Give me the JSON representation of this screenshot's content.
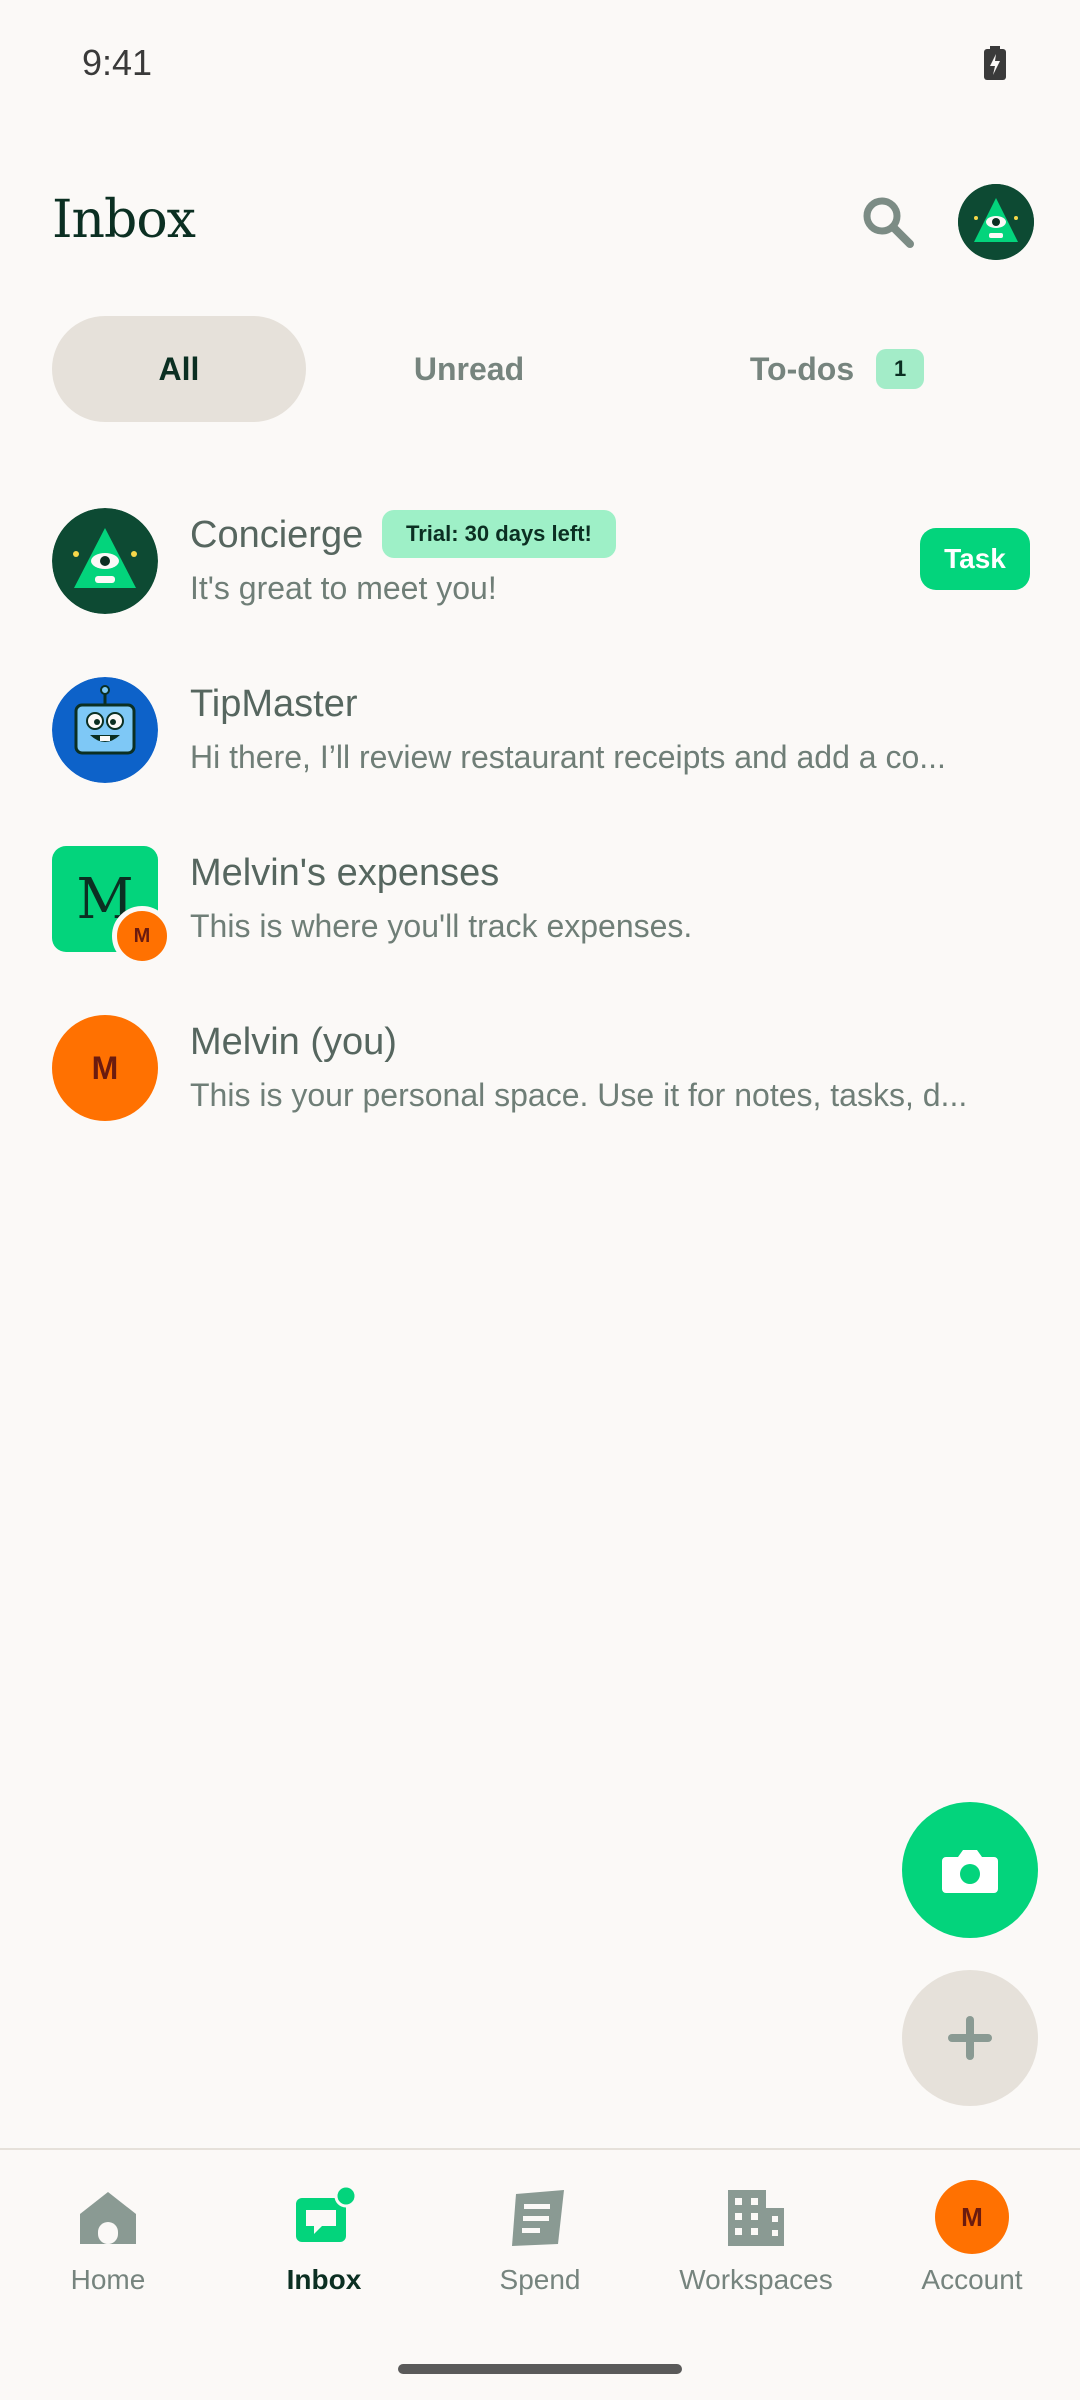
{
  "status_bar": {
    "time": "9:41"
  },
  "header": {
    "title": "Inbox"
  },
  "filters": {
    "all": "All",
    "unread": "Unread",
    "todos": "To-dos",
    "todos_count": "1"
  },
  "chats": [
    {
      "name": "Concierge",
      "badge": "Trial: 30 days left!",
      "preview": "It's great to meet you!",
      "action": "Task"
    },
    {
      "name": "TipMaster",
      "preview": "Hi there, I’ll review restaurant receipts and add a co..."
    },
    {
      "name": "Melvin's expenses",
      "preview": "This is where you'll track expenses.",
      "avatar_letter": "M",
      "owner_initial": "M"
    },
    {
      "name": "Melvin (you)",
      "preview": "This is your personal space. Use it for notes, tasks, d...",
      "avatar_initial": "M"
    }
  ],
  "bottom_nav": {
    "home": "Home",
    "inbox": "Inbox",
    "spend": "Spend",
    "workspaces": "Workspaces",
    "account": "Account",
    "account_initial": "M"
  },
  "colors": {
    "accent": "#03d47c",
    "background": "#fbf9f7",
    "chip": "#e6e1da",
    "avatar_orange": "#ff7101",
    "dark_green": "#0b2f22"
  }
}
